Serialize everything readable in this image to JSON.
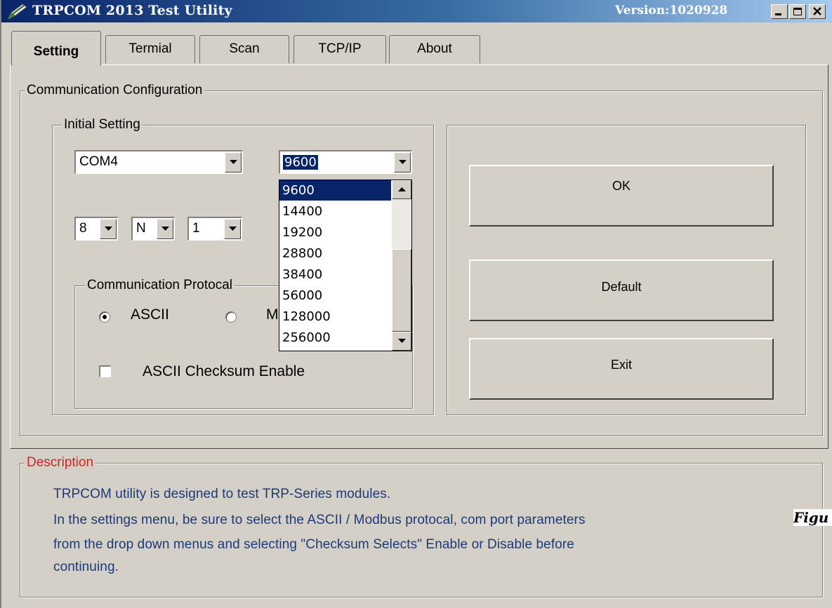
{
  "window": {
    "title": "TRPCOM 2013 Test Utility",
    "version": "Version:1020928",
    "icon": "pen-icon"
  },
  "tabs": [
    {
      "label": "Setting",
      "active": true
    },
    {
      "label": "Termial",
      "active": false
    },
    {
      "label": "Scan",
      "active": false
    },
    {
      "label": "TCP/IP",
      "active": false
    },
    {
      "label": "About",
      "active": false
    }
  ],
  "communication": {
    "group_label": "Communication Configuration",
    "initial_setting": {
      "group_label": "Initial Setting",
      "port": "COM4",
      "baud": "9600",
      "data_bits": "8",
      "parity": "N",
      "stop_bits": "1",
      "baud_options": [
        "9600",
        "14400",
        "19200",
        "28800",
        "38400",
        "56000",
        "128000",
        "256000"
      ],
      "baud_selected": "9600"
    },
    "protocol": {
      "group_label": "Communication Protocal",
      "ascii_label": "ASCII",
      "modbus_label": "Modbus",
      "selected": "ASCII",
      "checksum_label": "ASCII Checksum Enable",
      "checksum_checked": false
    }
  },
  "buttons": {
    "ok": "OK",
    "default": "Default",
    "exit": "Exit"
  },
  "description": {
    "group_label": "Description",
    "lines": [
      "TRPCOM utility is designed to test TRP-Series modules.",
      "In the settings menu, be sure to select the ASCII / Modbus protocal, com port parameters",
      "from the drop down menus and selecting  \"Checksum Selects\" Enable or Disable before",
      "continuing."
    ]
  },
  "side_caption": "Figu",
  "colors": {
    "face": "#d4d0c8",
    "title_start": "#0a246a",
    "title_end": "#a6caf0",
    "highlight": "#0a246a",
    "description_text": "#1c3a7a",
    "description_label": "#e02020"
  }
}
